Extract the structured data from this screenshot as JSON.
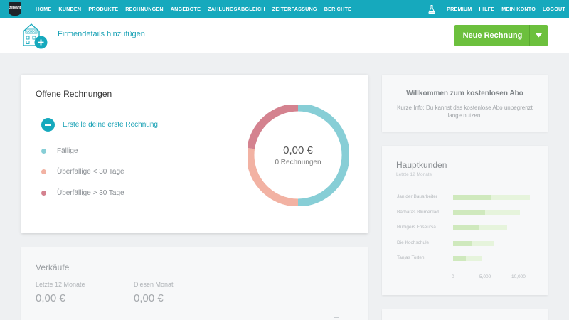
{
  "brand": {
    "logo_text": "zervant"
  },
  "nav": {
    "left": [
      "HOME",
      "KUNDEN",
      "PRODUKTE",
      "RECHNUNGEN",
      "ANGEBOTE",
      "ZAHLUNGSABGLEICH",
      "ZEITERFASSUNG",
      "BERICHTE"
    ],
    "right": [
      "PREMIUM",
      "HILFE",
      "MEIN KONTO",
      "LOGOUT"
    ]
  },
  "subheader": {
    "logo_placeholder": "LOGO",
    "company_link": "Firmendetails hinzufügen",
    "new_invoice_label": "Neue Rechnung"
  },
  "open_invoices": {
    "title": "Offene Rechnungen",
    "create_label": "Erstelle deine erste Rechnung",
    "legend": [
      {
        "label": "Fällige",
        "color": "#87ced6"
      },
      {
        "label": "Überfällige < 30 Tage",
        "color": "#f2b2a3"
      },
      {
        "label": "Überfällige > 30 Tage",
        "color": "#d4828f"
      }
    ],
    "total": "0,00 €",
    "count": "0 Rechnungen"
  },
  "sales": {
    "title": "Verkäufe",
    "last12_label": "Letzte 12 Monate",
    "last12_value": "0,00 €",
    "month_label": "Diesen Monat",
    "month_value": "0,00 €"
  },
  "welcome": {
    "title": "Willkommen zum kostenlosen Abo",
    "text": "Kurze Info: Du kannst das kostenlose Abo unbegrenzt lange nutzen."
  },
  "top_customers": {
    "title": "Hauptkunden",
    "subtitle": "Letzte 12 Monate",
    "axis_ticks": [
      "0",
      "5,000",
      "10,000"
    ]
  },
  "chart_data": {
    "type": "bar",
    "orientation": "horizontal",
    "title": "Hauptkunden",
    "subtitle": "Letzte 12 Monate",
    "categories": [
      "Jan der Bauarbeiter",
      "Barbaras Blumenlad...",
      "Rüdigers Friseursa...",
      "Die Kochschule",
      "Tanjas Torten"
    ],
    "series": [
      {
        "values": [
          12000,
          10500,
          8500,
          6500,
          4500
        ]
      },
      {
        "values": [
          6000,
          5000,
          4000,
          3000,
          2000
        ]
      }
    ],
    "xlim": [
      0,
      12500
    ],
    "x_ticks": [
      "0",
      "5,000",
      "10,000"
    ]
  },
  "colors": {
    "accent": "#16a9bd",
    "primary_button": "#6cc03d",
    "due": "#87ced6",
    "overdue_short": "#f2b2a3",
    "overdue_long": "#d4828f"
  }
}
